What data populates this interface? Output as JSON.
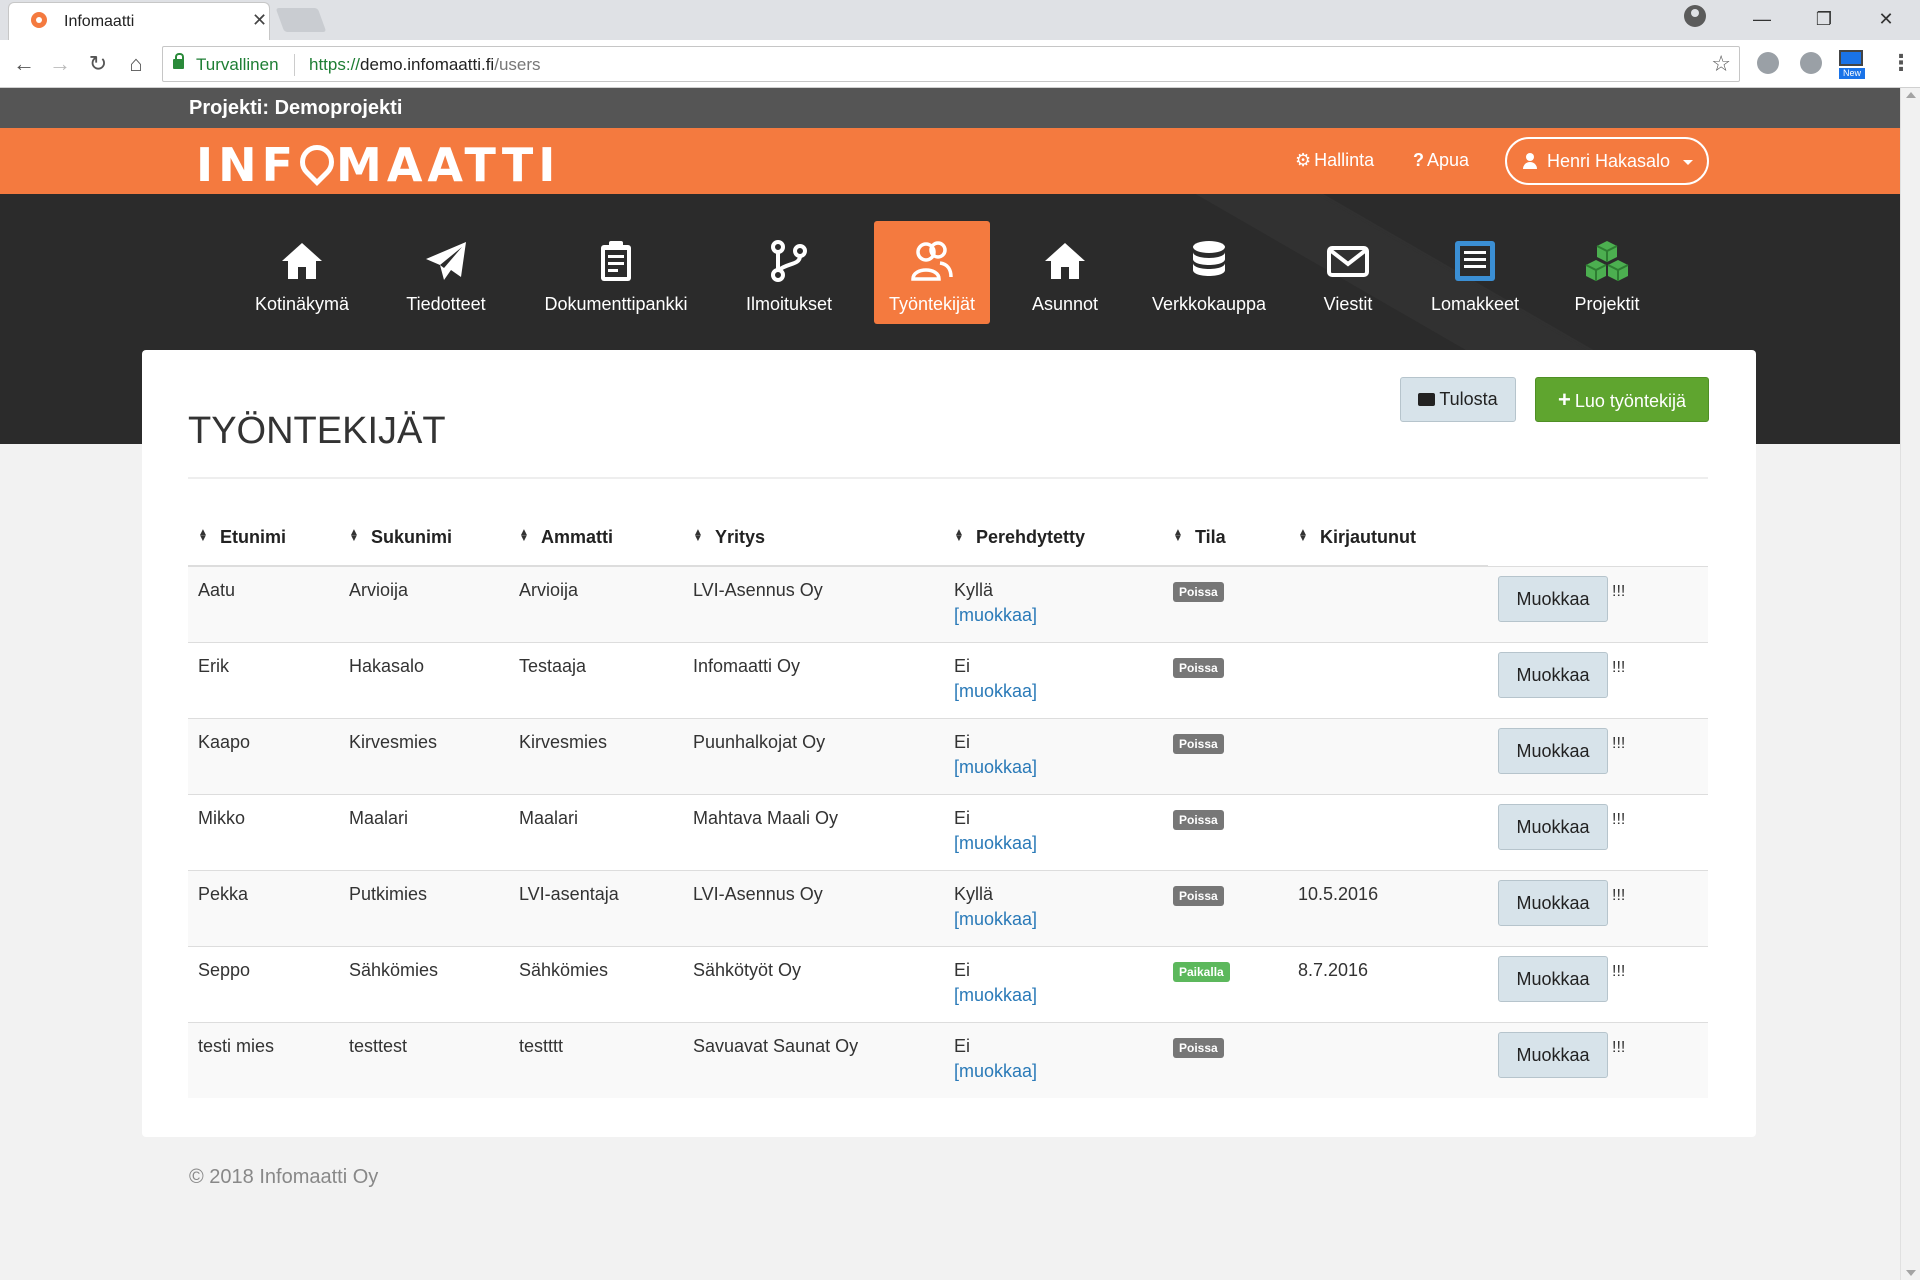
{
  "browser": {
    "tab_title": "Infomaatti",
    "secure_label": "Turvallinen",
    "url_scheme": "https://",
    "url_host": "demo.infomaatti.fi",
    "url_path": "/users",
    "ext_badge": "New"
  },
  "project": {
    "label": "Projekti: Demoprojekti"
  },
  "header": {
    "logo_left": "INF",
    "logo_right": "MAATTI",
    "admin_label": "Hallinta",
    "help_label": "Apua",
    "user_name": "Henri Hakasalo"
  },
  "nav": [
    {
      "label": "Kotinäkymä",
      "icon": "home-icon"
    },
    {
      "label": "Tiedotteet",
      "icon": "paper-plane-icon"
    },
    {
      "label": "Dokumenttipankki",
      "icon": "clipboard-icon"
    },
    {
      "label": "Ilmoitukset",
      "icon": "branch-icon"
    },
    {
      "label": "Työntekijät",
      "icon": "users-icon",
      "active": true
    },
    {
      "label": "Asunnot",
      "icon": "house-icon"
    },
    {
      "label": "Verkkokauppa",
      "icon": "database-icon"
    },
    {
      "label": "Viestit",
      "icon": "envelope-icon"
    },
    {
      "label": "Lomakkeet",
      "icon": "form-list-icon"
    },
    {
      "label": "Projektit",
      "icon": "cubes-icon"
    }
  ],
  "main": {
    "title": "TYÖNTEKIJÄT",
    "print_label": "Tulosta",
    "create_label": "Luo työntekijä"
  },
  "table": {
    "headers": [
      "Etunimi",
      "Sukunimi",
      "Ammatti",
      "Yritys",
      "Perehdytetty",
      "Tila",
      "Kirjautunut"
    ],
    "edit_link": "[muokkaa]",
    "edit_button": "Muokkaa",
    "flag": "!!!",
    "rows": [
      {
        "first": "Aatu",
        "last": "Arvioija",
        "job": "Arvioija",
        "company": "LVI-Asennus Oy",
        "inducted": "Kyllä",
        "status": "Poissa",
        "login": ""
      },
      {
        "first": "Erik",
        "last": "Hakasalo",
        "job": "Testaaja",
        "company": "Infomaatti Oy",
        "inducted": "Ei",
        "status": "Poissa",
        "login": ""
      },
      {
        "first": "Kaapo",
        "last": "Kirvesmies",
        "job": "Kirvesmies",
        "company": "Puunhalkojat Oy",
        "inducted": "Ei",
        "status": "Poissa",
        "login": ""
      },
      {
        "first": "Mikko",
        "last": "Maalari",
        "job": "Maalari",
        "company": "Mahtava Maali Oy",
        "inducted": "Ei",
        "status": "Poissa",
        "login": ""
      },
      {
        "first": "Pekka",
        "last": "Putkimies",
        "job": "LVI-asentaja",
        "company": "LVI-Asennus Oy",
        "inducted": "Kyllä",
        "status": "Poissa",
        "login": "10.5.2016"
      },
      {
        "first": "Seppo",
        "last": "Sähkömies",
        "job": "Sähkömies",
        "company": "Sähkötyöt Oy",
        "inducted": "Ei",
        "status": "Paikalla",
        "login": "8.7.2016"
      },
      {
        "first": "testi mies",
        "last": "testtest",
        "job": "testttt",
        "company": "Savuavat Saunat Oy",
        "inducted": "Ei",
        "status": "Poissa",
        "login": ""
      }
    ]
  },
  "footer": {
    "text": "© 2018 Infomaatti Oy"
  },
  "colors": {
    "brand_orange": "#f47a3f",
    "dark_nav": "#2b2b2b",
    "create_green": "#5fa52f",
    "status_away": "#777777",
    "status_present": "#5cb85c",
    "link_blue": "#2a7ab8"
  }
}
